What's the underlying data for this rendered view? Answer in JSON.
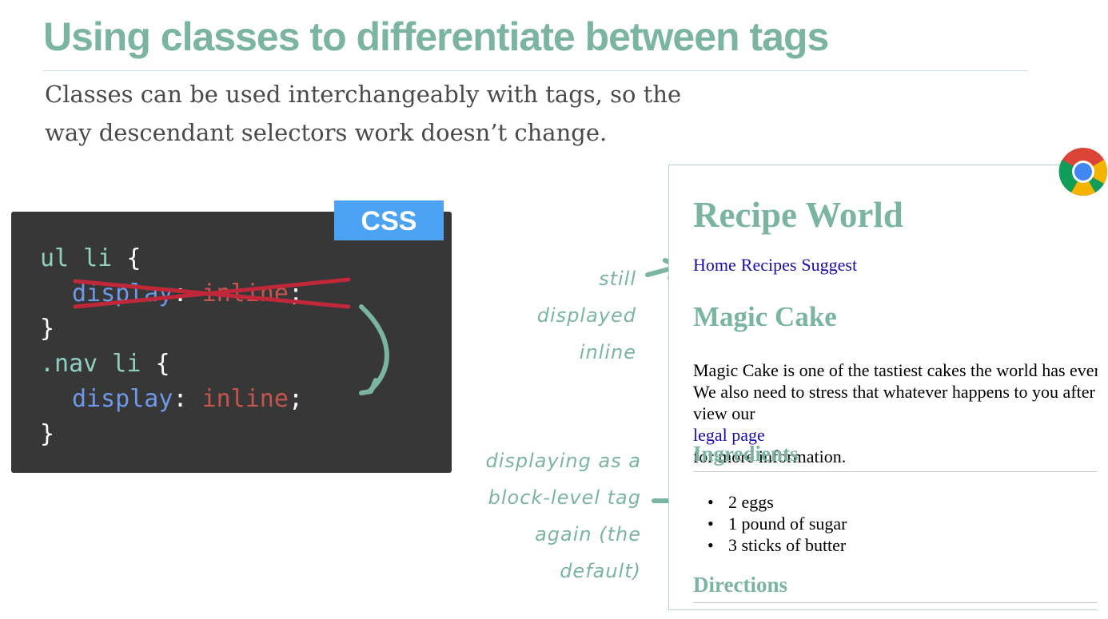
{
  "slide": {
    "title": "Using classes to differentiate between tags",
    "subtitle_lines": [
      "Classes can be used interchangeably with tags, so the",
      "way descendant selectors work doesn’t change."
    ]
  },
  "code": {
    "badge": "CSS",
    "line1_selector": "ul li",
    "line1_brace": " {",
    "line2_property": "display",
    "line2_colon": ": ",
    "line2_value": "inline",
    "line2_semicolon": ";",
    "line3_brace": "}",
    "line4_selector": ".nav li",
    "line4_brace": " {",
    "line5_property": "display",
    "line5_colon": ": ",
    "line5_value": "inline",
    "line5_semicolon": ";",
    "line6_brace": "}"
  },
  "browser": {
    "heading": "Recipe World",
    "nav": [
      "Home",
      "Recipes",
      "Suggest"
    ],
    "subheading": "Magic Cake",
    "paragraph": {
      "line1": "Magic Cake is one of the tastiest cakes the world has ever",
      "line2": "We also need to stress that whatever happens to you after",
      "line3_before": "view our ",
      "line3_link": "legal page",
      "line3_after": " for more information."
    },
    "ingredients_heading": "Ingredients",
    "ingredients": [
      "2 eggs",
      "1 pound of sugar",
      "3 sticks of butter"
    ],
    "directions_heading": "Directions"
  },
  "annotations": {
    "still_inline": [
      "still",
      "displayed",
      "inline"
    ],
    "block_level": [
      "displaying as a",
      "block-level tag",
      "again (the",
      "default)"
    ]
  },
  "colors": {
    "accent": "#7bb59f",
    "code_bg": "#373737",
    "badge_bg": "#4da3f3",
    "strike": "#c0283a",
    "link": "#1a0dab"
  },
  "icons": {
    "browser": "chrome-logo-icon"
  }
}
